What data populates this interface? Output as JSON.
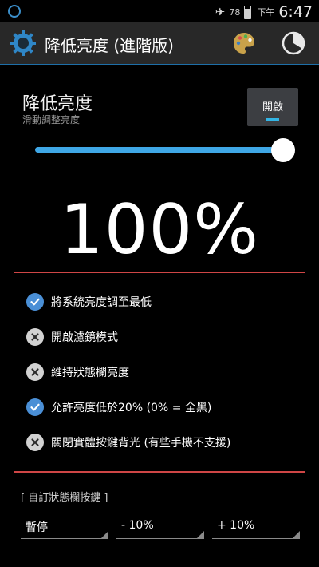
{
  "status_bar": {
    "battery_percent": "78",
    "battery_level": 0.78,
    "ampm": "下午",
    "time": "6:47"
  },
  "action_bar": {
    "title": "降低亮度 (進階版)",
    "icons": [
      "gear-logo-icon",
      "palette-icon",
      "timer-icon"
    ]
  },
  "brightness": {
    "title": "降低亮度",
    "subtitle": "滑動調整亮度",
    "toggle_label": "開啟",
    "slider_value_percent": 100,
    "value_text": "100%"
  },
  "options": [
    {
      "label": "將系統亮度調至最低",
      "checked": true
    },
    {
      "label": "開啟濾鏡模式",
      "checked": false
    },
    {
      "label": "維持狀態欄亮度",
      "checked": false
    },
    {
      "label": "允許亮度低於20% (0% = 全黑)",
      "checked": true
    },
    {
      "label": "關閉實體按鍵背光 (有些手機不支援)",
      "checked": false
    }
  ],
  "custom_buttons": {
    "label": "[ 自訂狀態欄按鍵 ]",
    "spinners": [
      "暫停",
      "- 10%",
      "+ 10%"
    ]
  },
  "colors": {
    "accent": "#33b5e5",
    "slider": "#3fa7e6",
    "checked": "#4a8fd6",
    "divider": "#cf4646"
  }
}
